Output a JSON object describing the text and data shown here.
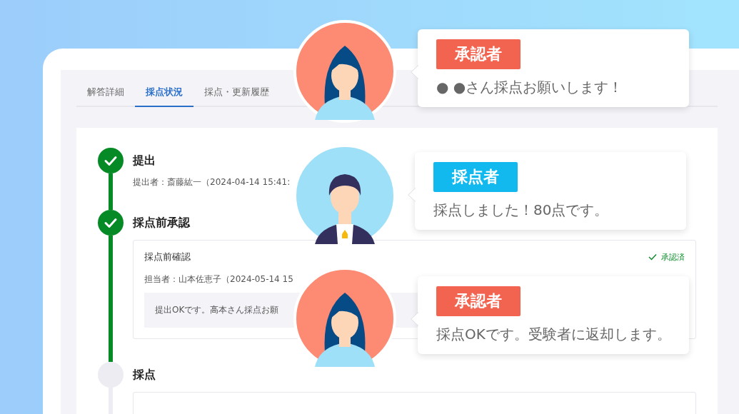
{
  "tabs": [
    {
      "label": "解答詳細",
      "selected": false
    },
    {
      "label": "採点状況",
      "selected": true
    },
    {
      "label": "採点・更新履歴",
      "selected": false
    }
  ],
  "steps": [
    {
      "kind": "text",
      "title": "提出",
      "done": true,
      "detail": "提出者：斎藤紘一（2024-04-14 15:41:"
    },
    {
      "kind": "approval",
      "title": "採点前承認",
      "done": true,
      "card": {
        "title": "採点前確認",
        "status": "承認済",
        "assignee": "担当者：山本佐恵子（2024-05-14 15",
        "comment": "提出OKです。高本さん採点お願"
      }
    },
    {
      "kind": "pending",
      "title": "採点",
      "done": false
    }
  ],
  "callouts": [
    {
      "kind": "woman",
      "role": "承認者",
      "color": "#f26450",
      "message": "● ●さん採点お願いします！"
    },
    {
      "kind": "man",
      "role": "採点者",
      "color": "#12b9ef",
      "message": "採点しました！80点です。"
    },
    {
      "kind": "woman",
      "role": "承認者",
      "color": "#f26450",
      "message": "採点OKです。受験者に返却します。"
    }
  ]
}
